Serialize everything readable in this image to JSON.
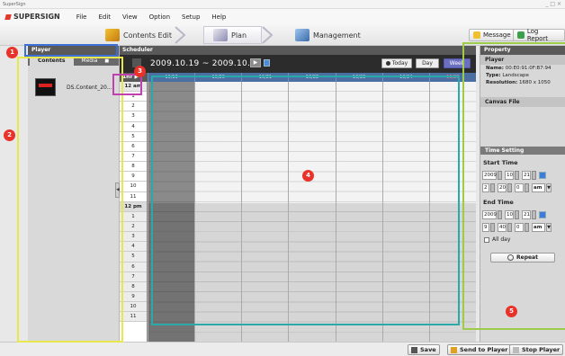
{
  "window": {
    "title": "SuperSign",
    "controls": "_ □ ×"
  },
  "menubar": {
    "logo": "SUPERSIGN",
    "items": [
      "File",
      "Edit",
      "View",
      "Option",
      "Setup",
      "Help"
    ]
  },
  "nav": {
    "tabs": [
      "Contents Edit",
      "Plan",
      "Management"
    ],
    "message_label": "Message",
    "log_label": "Log Report"
  },
  "left_panel": {
    "header": "Player",
    "tabs": [
      "Contents",
      "Media"
    ],
    "media_badge": "■",
    "items": [
      {
        "name": "DS.Content_20..."
      }
    ],
    "collapse_glyph": "◀"
  },
  "scheduler": {
    "header": "Scheduler",
    "date_range": "2009.10.19  ~  2009.10.25",
    "next_glyph": "▶",
    "today_label": "Today",
    "day_label": "Day",
    "week_label": "Week",
    "hour_header": "1hr",
    "days": [
      "10/19",
      "10/20",
      "10/21",
      "10/22",
      "10/23",
      "10/24",
      "10/25"
    ],
    "hours_am": [
      "12 am",
      "1",
      "2",
      "3",
      "4",
      "5",
      "6",
      "7",
      "8",
      "9",
      "10",
      "11"
    ],
    "hours_pm": [
      "12 pm",
      "1",
      "2",
      "3",
      "4",
      "5",
      "6",
      "7",
      "8",
      "9",
      "10",
      "11"
    ]
  },
  "property": {
    "header": "Property",
    "player_title": "Player",
    "name_label": "Name:",
    "name_value": "00:E0:91:0F:B7:94",
    "type_label": "Type:",
    "type_value": "Landscape",
    "resolution_label": "Resolution:",
    "resolution_value": "1680 x 1050",
    "canvas_title": "Canvas File",
    "time_header": "Time Setting",
    "start_title": "Start Time",
    "start_date": [
      "2009",
      "10",
      "21"
    ],
    "start_time": [
      "2",
      "20",
      "0"
    ],
    "start_ampm": "am",
    "end_title": "End Time",
    "end_date": [
      "2009",
      "10",
      "21"
    ],
    "end_time": [
      "9",
      "40",
      "0"
    ],
    "end_ampm": "am",
    "allday_label": "All day",
    "repeat_label": "Repeat"
  },
  "bottom": {
    "save_label": "Save",
    "send_label": "Send to Player",
    "stop_label": "Stop Player"
  },
  "annotations": {
    "badges": [
      "1",
      "2",
      "3",
      "4",
      "5"
    ],
    "colors": {
      "blue": "#3c6fd8",
      "yellow": "#e8e84a",
      "magenta": "#c040b0",
      "teal": "#2aa9a9",
      "green": "#9ccc4a",
      "badge": "#e8322a"
    }
  }
}
